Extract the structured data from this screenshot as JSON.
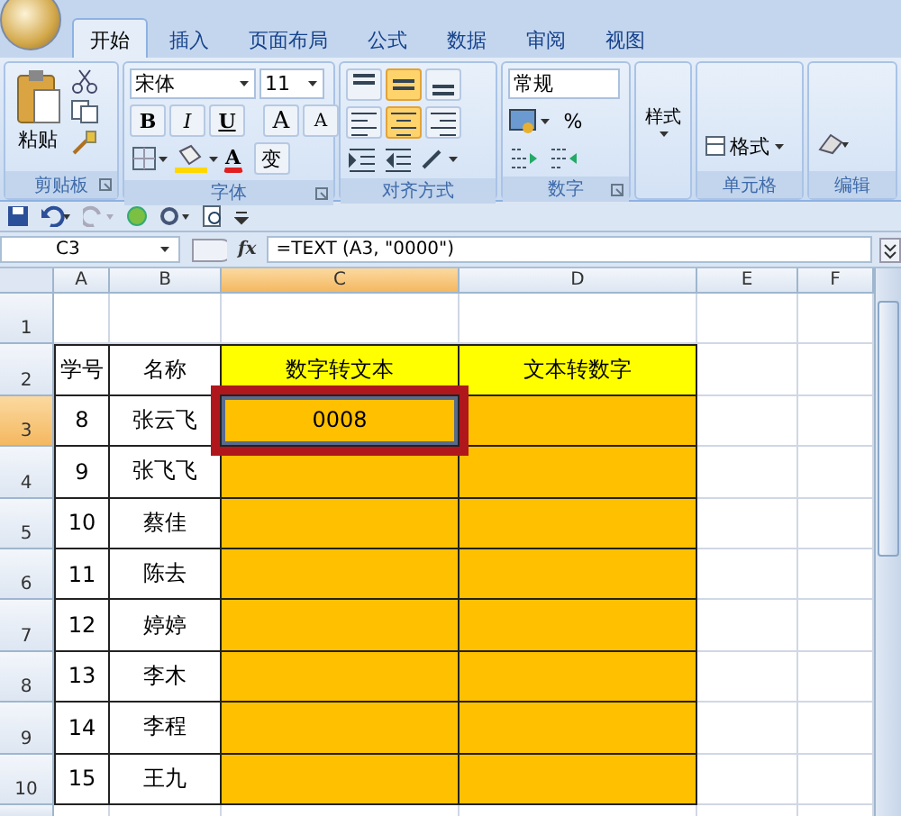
{
  "tabs": [
    {
      "label": "开始",
      "selected": true
    },
    {
      "label": "插入",
      "selected": false
    },
    {
      "label": "页面布局",
      "selected": false
    },
    {
      "label": "公式",
      "selected": false
    },
    {
      "label": "数据",
      "selected": false
    },
    {
      "label": "审阅",
      "selected": false
    },
    {
      "label": "视图",
      "selected": false
    }
  ],
  "ribbon": {
    "groups": [
      {
        "kind": "clipboard",
        "label": "剪贴板",
        "paste": "粘贴"
      },
      {
        "kind": "font",
        "label": "字体",
        "font_name": "宋体",
        "font_size": "11",
        "styles": [
          "B",
          "I",
          "U"
        ],
        "grow": "A",
        "shrink": "A",
        "color_letter": "A",
        "phonetic": "变"
      },
      {
        "kind": "alignment",
        "label": "对齐方式",
        "buttons": [
          {
            "kind": "top",
            "selected": false
          },
          {
            "kind": "middle",
            "selected": true
          },
          {
            "kind": "bottom",
            "selected": false
          },
          {
            "kind": "left",
            "selected": false
          },
          {
            "kind": "center",
            "selected": true
          },
          {
            "kind": "right",
            "selected": false
          }
        ]
      },
      {
        "kind": "number",
        "label": "数字",
        "format": "常规",
        "percent": "%"
      },
      {
        "kind": "styles",
        "button": "样式"
      },
      {
        "kind": "cells",
        "label": "单元格",
        "button": "格式"
      },
      {
        "kind": "editing",
        "label": "编辑"
      }
    ]
  },
  "formula_bar": {
    "name_box": "C3",
    "fx": "fx",
    "formula": "=TEXT (A3, \"0000\")"
  },
  "sheet": {
    "columns": [
      {
        "label": "A",
        "selected": false
      },
      {
        "label": "B",
        "selected": false
      },
      {
        "label": "C",
        "selected": true
      },
      {
        "label": "D",
        "selected": false
      },
      {
        "label": "E",
        "selected": false
      },
      {
        "label": "F",
        "selected": false
      }
    ],
    "rows": [
      {
        "number": "1",
        "selected": false
      },
      {
        "number": "2",
        "selected": false,
        "cells": [
          {
            "text": "学号",
            "color": "#ffffff",
            "selected": false
          },
          {
            "text": "名称",
            "color": "#ffffff",
            "selected": false
          },
          {
            "text": "数字转文本",
            "color": "#ffff00",
            "selected": false
          },
          {
            "text": "文本转数字",
            "color": "#ffff00",
            "selected": false
          }
        ]
      },
      {
        "number": "3",
        "selected": true,
        "cells": [
          {
            "text": "8",
            "color": "#ffffff",
            "selected": false
          },
          {
            "text": "张云飞",
            "color": "#ffffff",
            "selected": false
          },
          {
            "text": "0008",
            "color": "#ffc000",
            "selected": true
          },
          {
            "color": "#ffc000",
            "selected": false
          }
        ]
      },
      {
        "number": "4",
        "selected": false,
        "cells": [
          {
            "text": "9",
            "color": "#ffffff",
            "selected": false
          },
          {
            "text": "张飞飞",
            "color": "#ffffff",
            "selected": false
          },
          {
            "color": "#ffc000",
            "selected": false
          },
          {
            "color": "#ffc000",
            "selected": false
          }
        ]
      },
      {
        "number": "5",
        "selected": false,
        "cells": [
          {
            "text": "10",
            "color": "#ffffff",
            "selected": false
          },
          {
            "text": "蔡佳",
            "color": "#ffffff",
            "selected": false
          },
          {
            "color": "#ffc000",
            "selected": false
          },
          {
            "color": "#ffc000",
            "selected": false
          }
        ]
      },
      {
        "number": "6",
        "selected": false,
        "cells": [
          {
            "text": "11",
            "color": "#ffffff",
            "selected": false
          },
          {
            "text": "陈去",
            "color": "#ffffff",
            "selected": false
          },
          {
            "color": "#ffc000",
            "selected": false
          },
          {
            "color": "#ffc000",
            "selected": false
          }
        ]
      },
      {
        "number": "7",
        "selected": false,
        "cells": [
          {
            "text": "12",
            "color": "#ffffff",
            "selected": false
          },
          {
            "text": "婷婷",
            "color": "#ffffff",
            "selected": false
          },
          {
            "color": "#ffc000",
            "selected": false
          },
          {
            "color": "#ffc000",
            "selected": false
          }
        ]
      },
      {
        "number": "8",
        "selected": false,
        "cells": [
          {
            "text": "13",
            "color": "#ffffff",
            "selected": false
          },
          {
            "text": "李木",
            "color": "#ffffff",
            "selected": false
          },
          {
            "color": "#ffc000",
            "selected": false
          },
          {
            "color": "#ffc000",
            "selected": false
          }
        ]
      },
      {
        "number": "9",
        "selected": false,
        "cells": [
          {
            "text": "14",
            "color": "#ffffff",
            "selected": false
          },
          {
            "text": "李程",
            "color": "#ffffff",
            "selected": false
          },
          {
            "color": "#ffc000",
            "selected": false
          },
          {
            "color": "#ffc000",
            "selected": false
          }
        ]
      },
      {
        "number": "10",
        "selected": false,
        "cells": [
          {
            "text": "15",
            "color": "#ffffff",
            "selected": false
          },
          {
            "text": "王九",
            "color": "#ffffff",
            "selected": false
          },
          {
            "color": "#ffc000",
            "selected": false
          },
          {
            "color": "#ffc000",
            "selected": false
          }
        ]
      }
    ]
  }
}
